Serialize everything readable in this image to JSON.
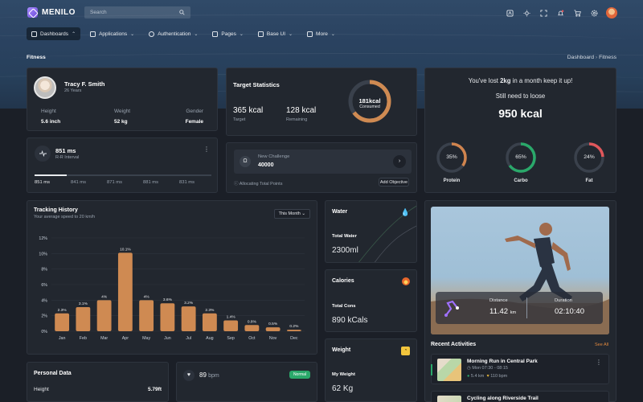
{
  "app": {
    "name": "MENILO"
  },
  "search": {
    "placeholder": "Search"
  },
  "nav": [
    {
      "label": "Dashboards",
      "active": true
    },
    {
      "label": "Applications"
    },
    {
      "label": "Authentication"
    },
    {
      "label": "Pages"
    },
    {
      "label": "Base UI"
    },
    {
      "label": "More"
    }
  ],
  "page": {
    "title": "Fitness",
    "breadcrumb": [
      "Dashboard",
      "Fitness"
    ]
  },
  "profile": {
    "name": "Tracy F. Smith",
    "age": "26 Years",
    "height_label": "Height",
    "height": "5.6 inch",
    "weight_label": "Weight",
    "weight": "52 kg",
    "gender_label": "Gender",
    "gender": "Female"
  },
  "rr": {
    "value": "851 ms",
    "label": "R-R Interval",
    "ticks": [
      "851 ms",
      "841 ms",
      "871 ms",
      "881 ms",
      "831 ms"
    ]
  },
  "target": {
    "title": "Target Statistics",
    "total": "365 kcal",
    "total_label": "Target",
    "remaining": "128 kcal",
    "remaining_label": "Remaining",
    "ring_value": "181kcal",
    "ring_label": "Consumed",
    "ring_progress": 0.65
  },
  "challenge": {
    "label": "New Challenge",
    "value": "40000",
    "note": "Allocating Total Points",
    "button": "Add Objective"
  },
  "loss": {
    "line1_pre": "You've lost ",
    "line1_bold": "2kg",
    "line1_post": " in a month keep it up!",
    "line2": "Still need to loose",
    "value": "950 kcal",
    "macros": [
      {
        "label": "Protein",
        "value": "35%",
        "pct": 0.35,
        "color": "#d0844e"
      },
      {
        "label": "Carbo",
        "value": "65%",
        "pct": 0.65,
        "color": "#2aa86a"
      },
      {
        "label": "Fat",
        "value": "24%",
        "pct": 0.24,
        "color": "#e0575b"
      }
    ]
  },
  "tracking": {
    "title": "Tracking History",
    "subtitle": "Your average speed to 20 km/h",
    "filter": "This Month"
  },
  "chart_data": {
    "type": "bar",
    "categories": [
      "Jan",
      "Feb",
      "Mar",
      "Apr",
      "May",
      "Jun",
      "Jul",
      "Aug",
      "Sep",
      "Oct",
      "Nov",
      "Dec"
    ],
    "values": [
      2.3,
      3.1,
      4,
      10.1,
      4,
      3.6,
      3.2,
      2.3,
      1.4,
      0.8,
      0.5,
      0.2
    ],
    "labels": [
      "2.3%",
      "3.1%",
      "4%",
      "10.1%",
      "4%",
      "3.6%",
      "3.2%",
      "2.3%",
      "1.4%",
      "0.8%",
      "0.5%",
      "0.2%"
    ],
    "yticks": [
      "0%",
      "2%",
      "4%",
      "6%",
      "8%",
      "10%",
      "12%"
    ],
    "ylim": [
      0,
      12
    ],
    "bar_color": "#cf8a52"
  },
  "water": {
    "title": "Water",
    "label": "Total Water",
    "value": "2300ml"
  },
  "calories": {
    "title": "Calories",
    "label": "Total Cons",
    "value": "890 kCals"
  },
  "weight": {
    "title": "Weight",
    "label": "My Weight",
    "value": "62 Kg"
  },
  "run": {
    "distance_label": "Distance",
    "distance": "11.42",
    "distance_unit": "km",
    "duration_label": "Duration",
    "duration": "02:10:40"
  },
  "activities": {
    "title": "Recent Activities",
    "see_all": "See All",
    "items": [
      {
        "title": "Morning Run in Central Park",
        "time": "Mon 07:30 - 08:15",
        "dist": "5.4 km",
        "bpm": "110 bpm"
      },
      {
        "title": "Cycling along Riverside Trail"
      }
    ]
  },
  "personal": {
    "title": "Personal Data",
    "row_label": "Height",
    "row_value": "5.79ft"
  },
  "heart": {
    "value": "89",
    "unit": "bpm",
    "status": "Normal"
  }
}
